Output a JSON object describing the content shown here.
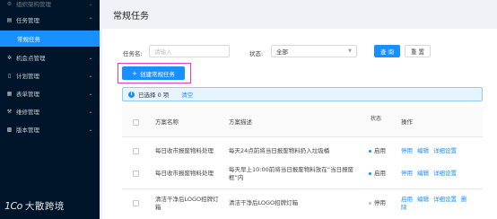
{
  "sidebar": {
    "items": [
      {
        "icon": "gear-icon",
        "label": "组织架构管理",
        "expanded": false
      },
      {
        "icon": "document-icon",
        "label": "任务管理",
        "expanded": true
      },
      {
        "label": "常规任务",
        "active": true
      },
      {
        "icon": "settings-icon",
        "label": "机会点管理"
      },
      {
        "icon": "doc-icon",
        "label": "计划管理"
      },
      {
        "icon": "table-icon",
        "label": "表单管理"
      },
      {
        "icon": "wrench-icon",
        "label": "维修管理"
      },
      {
        "icon": "grid-icon",
        "label": "版本管理"
      }
    ],
    "logo_mark": "1Co",
    "logo_text": "大散跨境"
  },
  "page": {
    "title": "常规任务"
  },
  "filters": {
    "name_label": "任务名:",
    "name_placeholder": "请输入",
    "status_label": "状态:",
    "status_value": "全部",
    "query_label": "查 询",
    "reset_label": "重 置"
  },
  "create_button": "创建常规任务",
  "selection": {
    "text": "已选择 0 项",
    "clear": "清空"
  },
  "colors": {
    "primary": "#1890ff",
    "sidebar": "#001529",
    "highlight": "#e040c8",
    "enabled_dot": "#1890ff",
    "disabled_dot": "#bfbfbf"
  },
  "table": {
    "columns": {
      "name": "方案名称",
      "desc": "方案描述",
      "status": "状态",
      "ops": "操作"
    },
    "rows": [
      {
        "name": "每日收市报废物料处理",
        "desc_lines": [
          "每天24点前将当日报废物料扔入垃圾桶"
        ],
        "status": "启用",
        "enabled": true,
        "actions": [
          "停用",
          "编辑",
          "详细设置"
        ]
      },
      {
        "name": "每日收市报废物料处理",
        "desc_lines": [
          "每天早上10:00前将当日报废物料放在“当日报废",
          "框”内"
        ],
        "status": "启用",
        "enabled": true,
        "actions": [
          "停用",
          "编辑",
          "详细设置"
        ]
      },
      {
        "name_lines": [
          "清洁干净后LOGO招牌灯",
          "箱"
        ],
        "desc_lines": [
          "清洁干净后LOGO招牌灯箱"
        ],
        "status": "停用",
        "enabled": false,
        "actions": [
          "启用",
          "编辑",
          "详细设置",
          "删",
          "除"
        ]
      }
    ]
  }
}
